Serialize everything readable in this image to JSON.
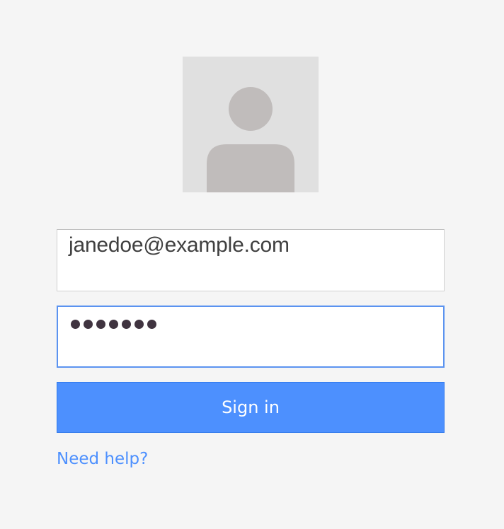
{
  "avatar": {
    "icon": "default-user-silhouette-icon",
    "background_color": "#e0e0e0",
    "silhouette_color": "#c0bcbb"
  },
  "login_form": {
    "email": {
      "value": "janedoe@example.com"
    },
    "password": {
      "masked_length": 7
    },
    "sign_in_button": {
      "label": "Sign in",
      "color": "#4d90fe"
    },
    "need_help_link": {
      "label": "Need help?",
      "color": "#4d90fe"
    }
  }
}
